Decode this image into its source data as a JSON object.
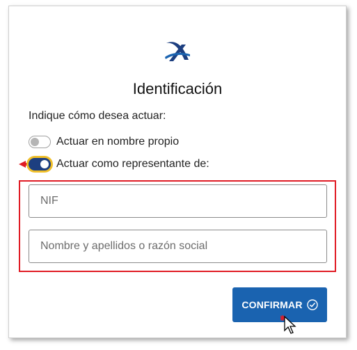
{
  "dialog": {
    "title": "Identificación",
    "prompt": "Indique cómo desea actuar:",
    "options": [
      {
        "label": "Actuar en nombre propio",
        "checked": false
      },
      {
        "label": "Actuar como representante de:",
        "checked": true
      }
    ],
    "fields": {
      "nif_placeholder": "NIF",
      "name_placeholder": "Nombre y apellidos o razón social"
    },
    "confirm_label": "CONFIRMAR"
  },
  "colors": {
    "brand": "#1d3f80",
    "button": "#1a63b0",
    "highlight": "#e01b24",
    "focus_ring": "#f0bf2a"
  },
  "icons": [
    "agency-logo-icon",
    "toggle-switch",
    "red-arrow-icon",
    "check-circle-icon",
    "mouse-cursor-icon"
  ]
}
